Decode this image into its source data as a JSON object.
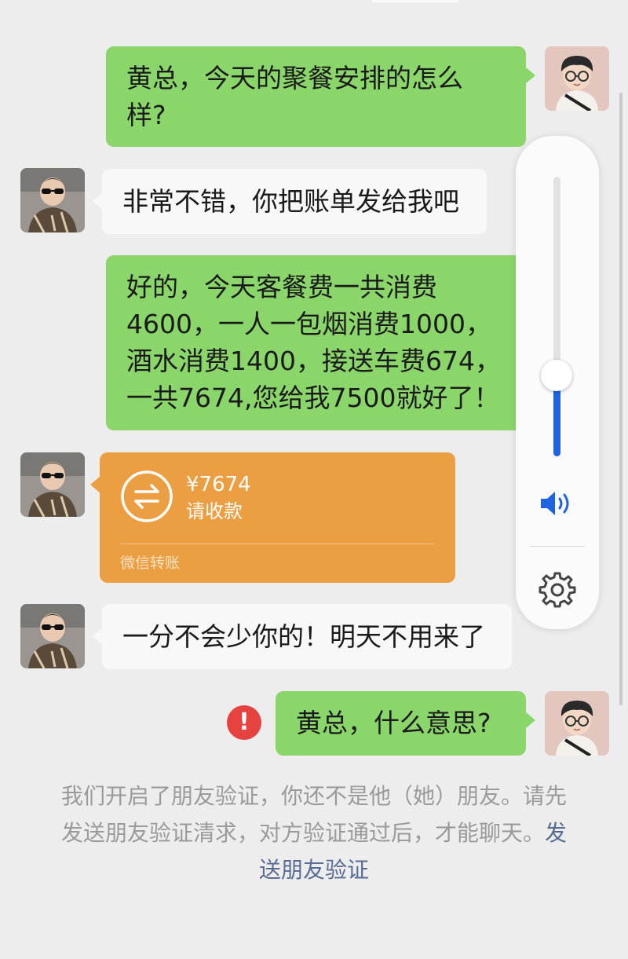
{
  "messages": [
    {
      "id": 1,
      "side": "right",
      "text_lines": [
        "黄总，今天的聚餐安排的怎么",
        "样?"
      ]
    },
    {
      "id": 2,
      "side": "left",
      "text_lines": [
        "非常不错，你把账单发给我吧"
      ]
    },
    {
      "id": 3,
      "side": "right",
      "text_lines": [
        "好的，今天客餐费一共消费",
        "4600，一人一包烟消费1000，",
        "酒水消费1400，接送车费674，",
        "一共7674,您给我7500就好了！"
      ]
    },
    {
      "id": 4,
      "side": "left",
      "type": "transfer",
      "amount": "¥7674",
      "label": "请收款",
      "footer": "微信转账"
    },
    {
      "id": 5,
      "side": "left",
      "text_lines": [
        "一分不会少你的！明天不用来了"
      ]
    },
    {
      "id": 6,
      "side": "right",
      "text_lines": [
        "黄总，什么意思?"
      ],
      "status": "failed",
      "status_icon": "exclamation-icon",
      "status_symbol": "!"
    }
  ],
  "system_message": {
    "lines": [
      "我们开启了朋友验证，你还不是他（她）朋友。请先",
      "发送朋友验证清求，对方验证通过后，才能聊天。"
    ],
    "link_lines": [
      "发",
      "送朋友验证"
    ]
  },
  "volume_control": {
    "level": 0.29,
    "speaker_icon": "speaker-icon",
    "settings_icon": "gear-icon",
    "accent_color": "#1e63e6"
  },
  "colors": {
    "background": "#ededed",
    "sent_bubble": "#8bd66a",
    "received_bubble": "#f8f8f8",
    "transfer_card": "#ec9e42",
    "error": "#e64340",
    "link": "#576b95"
  }
}
